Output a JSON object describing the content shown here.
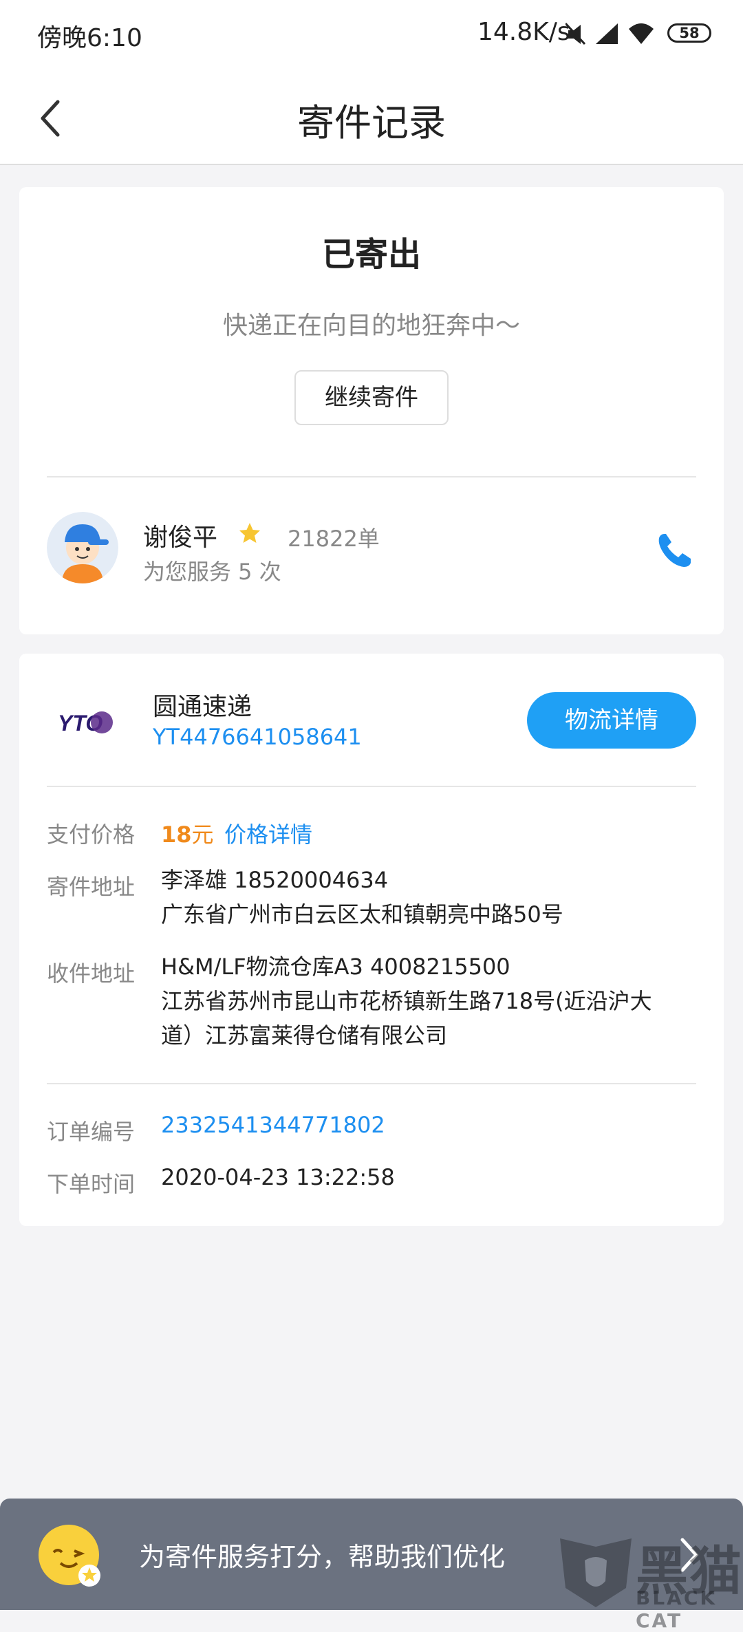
{
  "status_bar": {
    "time": "傍晚6:10",
    "net_speed": "14.8K/s",
    "battery": "58"
  },
  "nav": {
    "title": "寄件记录"
  },
  "shipment_status": {
    "title": "已寄出",
    "subtitle": "快递正在向目的地狂奔中～",
    "continue_label": "继续寄件"
  },
  "courier": {
    "name": "谢俊平",
    "orders": "21822单",
    "served": "为您服务 5 次"
  },
  "carrier": {
    "name": "圆通速递",
    "tracking_no": "YT4476641058641",
    "logistics_label": "物流详情",
    "logo_text": "YTO"
  },
  "details": {
    "price_label": "支付价格",
    "price_amount": "18",
    "price_unit": "元",
    "price_link": "价格详情",
    "sender_label": "寄件地址",
    "sender_line1": "李泽雄 18520004634",
    "sender_line2": "广东省广州市白云区太和镇朝亮中路50号",
    "receiver_label": "收件地址",
    "receiver_line1": "H&M/LF物流仓库A3 4008215500",
    "receiver_line2": "江苏省苏州市昆山市花桥镇新生路718号(近沿沪大",
    "receiver_line3": "道）江苏富莱得仓储有限公司",
    "order_label": "订单编号",
    "order_no": "2332541344771802",
    "time_label": "下单时间",
    "order_time": "2020-04-23 13:22:58"
  },
  "toast": {
    "text": "为寄件服务打分，帮助我们优化"
  },
  "watermark": {
    "cn": "黑猫",
    "en": "BLACK CAT"
  },
  "colors": {
    "accent": "#1fa0f5",
    "link": "#1d8ff0",
    "price": "#f08a1c"
  }
}
